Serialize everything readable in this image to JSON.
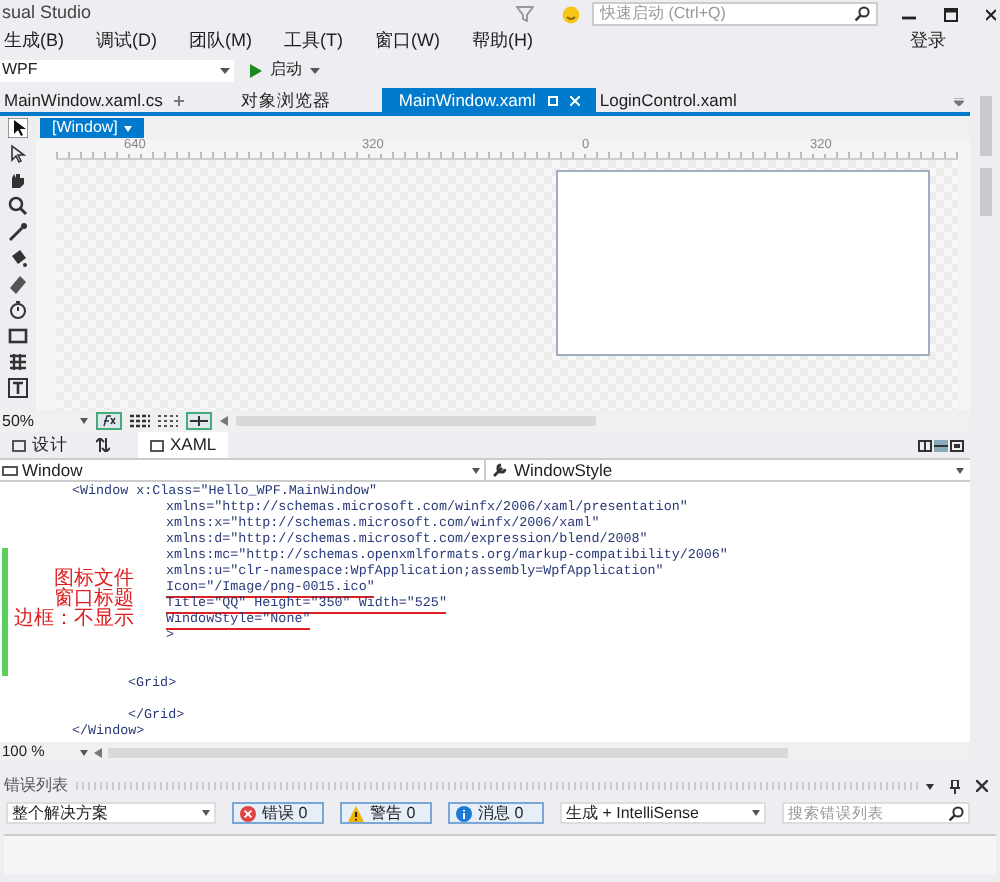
{
  "title_bar": {
    "title": "sual Studio",
    "quick_launch_placeholder": "快速启动 (Ctrl+Q)"
  },
  "menu": [
    "生成(B)",
    "调试(D)",
    "团队(M)",
    "工具(T)",
    "窗口(W)",
    "帮助(H)"
  ],
  "sign_in": "登录",
  "toolbar": {
    "platform": "WPF",
    "start": "启动"
  },
  "doc_tabs": [
    {
      "label": "MainWindow.xaml.cs",
      "selected": false
    },
    {
      "label": "对象浏览器",
      "selected": false
    },
    {
      "label": "MainWindow.xaml",
      "selected": true
    },
    {
      "label": "LoginControl.xaml",
      "selected": false
    }
  ],
  "designer": {
    "element": "[Window]",
    "ruler": [
      "640",
      "320",
      "0",
      "320"
    ],
    "zoom": "50%"
  },
  "view_tabs": [
    {
      "label": "设计",
      "selected": false
    },
    {
      "label": "XAML",
      "selected": true
    }
  ],
  "nav": {
    "element": "Window",
    "property": "WindowStyle"
  },
  "code": [
    {
      "kind": "tag",
      "text": "<Window x:Class=\"Hello_WPF.MainWindow\"",
      "changed": false
    },
    {
      "kind": "attr",
      "text": "xmlns=\"http://schemas.microsoft.com/winfx/2006/xaml/presentation\"",
      "changed": false
    },
    {
      "kind": "attr",
      "text": "xmlns:x=\"http://schemas.microsoft.com/winfx/2006/xaml\"",
      "changed": false
    },
    {
      "kind": "attr",
      "text": "xmlns:d=\"http://schemas.microsoft.com/expression/blend/2008\"",
      "changed": false
    },
    {
      "kind": "attr",
      "text": "xmlns:mc=\"http://schemas.openxmlformats.org/markup-compatibility/2006\"",
      "changed": true
    },
    {
      "kind": "attr",
      "text": "xmlns:u=\"clr-namespace:WpfApplication;assembly=WpfApplication\"",
      "changed": true
    },
    {
      "kind": "attr",
      "text": "Icon=\"/Image/png-0015.ico\"",
      "changed": true,
      "note": "图标文件"
    },
    {
      "kind": "attr",
      "text": "Title=\"QQ\" Height=\"350\" Width=\"525\"",
      "changed": true,
      "note": "窗口标题"
    },
    {
      "kind": "attr",
      "text": "WindowStyle=\"None\"",
      "changed": true,
      "note": "边框：不显示"
    },
    {
      "kind": "attr",
      "text": ">",
      "changed": true
    },
    {
      "kind": "blank",
      "changed": true
    },
    {
      "kind": "blank",
      "changed": true
    },
    {
      "kind": "child",
      "text": "<Grid>",
      "changed": false
    },
    {
      "kind": "blank",
      "changed": false
    },
    {
      "kind": "child",
      "text": "</Grid>",
      "changed": false
    },
    {
      "kind": "tag",
      "text": "</Window>",
      "changed": false
    }
  ],
  "code_zoom": "100 %",
  "error_list": {
    "title": "错误列表",
    "scope": "整个解决方案",
    "errors": "错误 0",
    "warnings": "警告 0",
    "messages": "消息 0",
    "build": "生成 + IntelliSense",
    "search_placeholder": "搜索错误列表"
  }
}
